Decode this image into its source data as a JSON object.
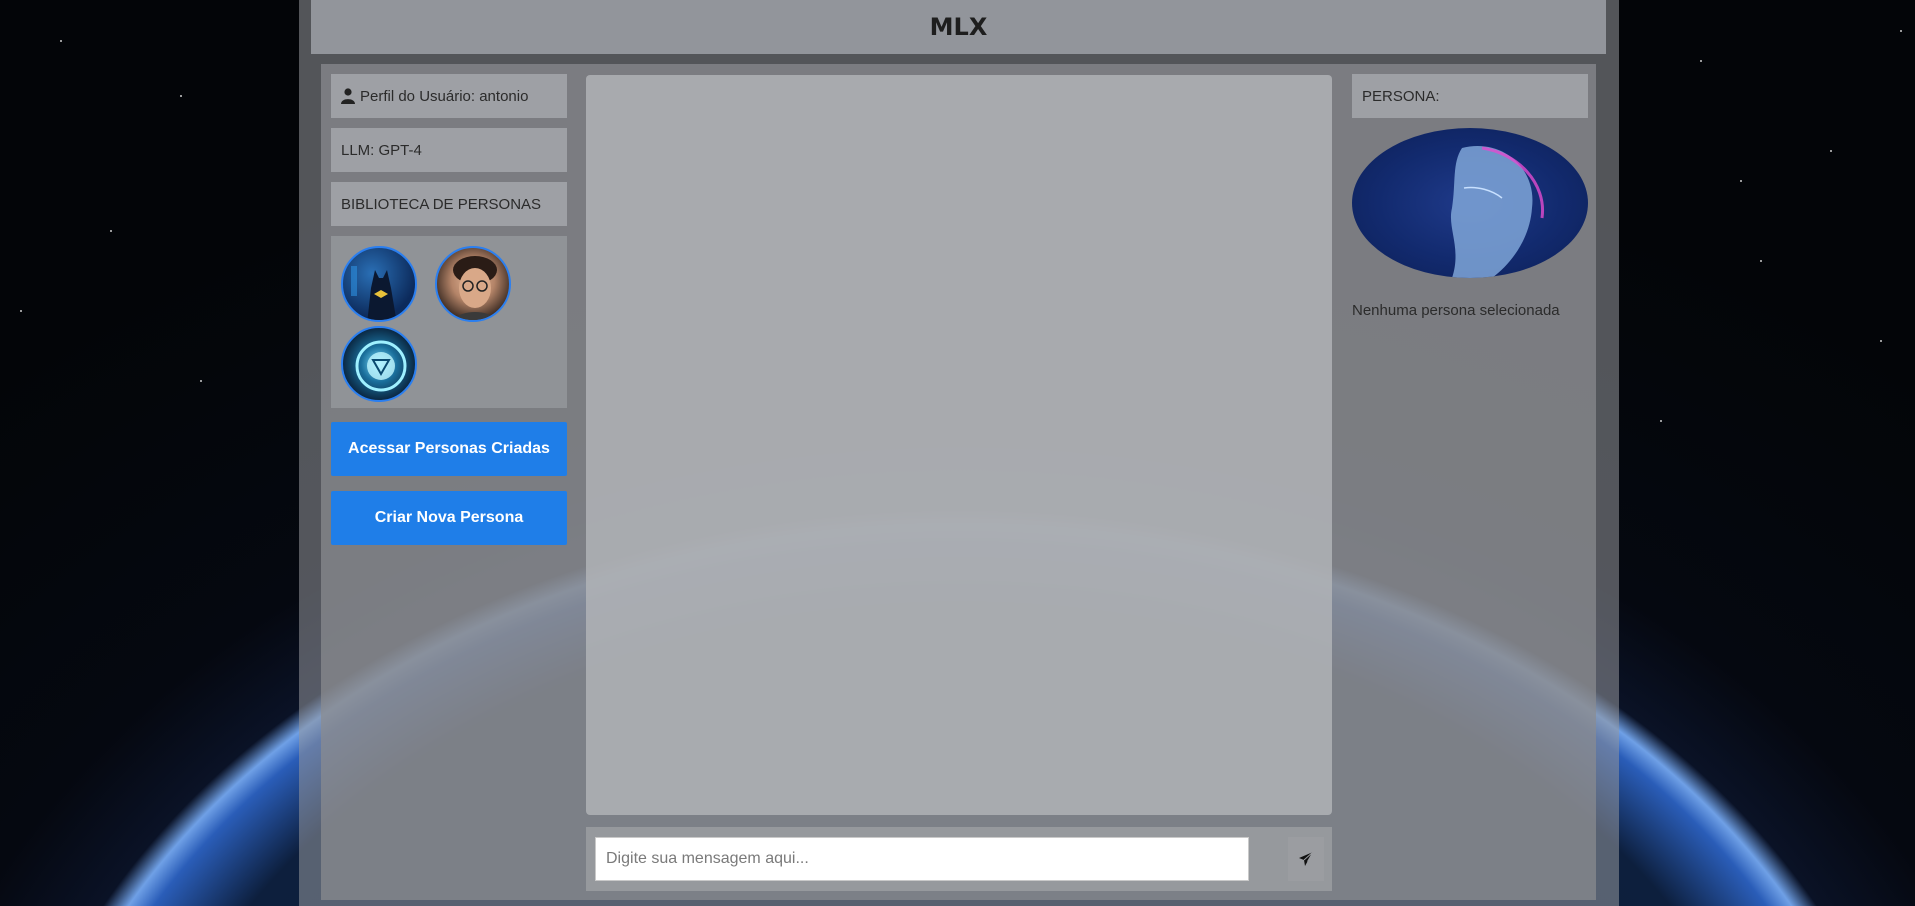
{
  "header": {
    "title": "MLX"
  },
  "sidebar": {
    "user_profile": "Perfil do Usuário: antonio",
    "user_icon": "user-icon",
    "llm": "LLM: GPT-4",
    "library_title": "BIBLIOTECA DE PERSONAS",
    "avatars": [
      "batman-avatar",
      "harry-potter-avatar",
      "arc-reactor-avatar"
    ],
    "access_button": "Acessar Personas Criadas",
    "create_button": "Criar Nova Persona"
  },
  "chat": {
    "input_placeholder": "Digite sua mensagem aqui...",
    "send_icon": "send-icon"
  },
  "persona_panel": {
    "title": "PERSONA:",
    "status": "Nenhuma persona selecionada"
  },
  "colors": {
    "accent": "#1f7ee8",
    "avatar_border": "#2b7ff0"
  }
}
